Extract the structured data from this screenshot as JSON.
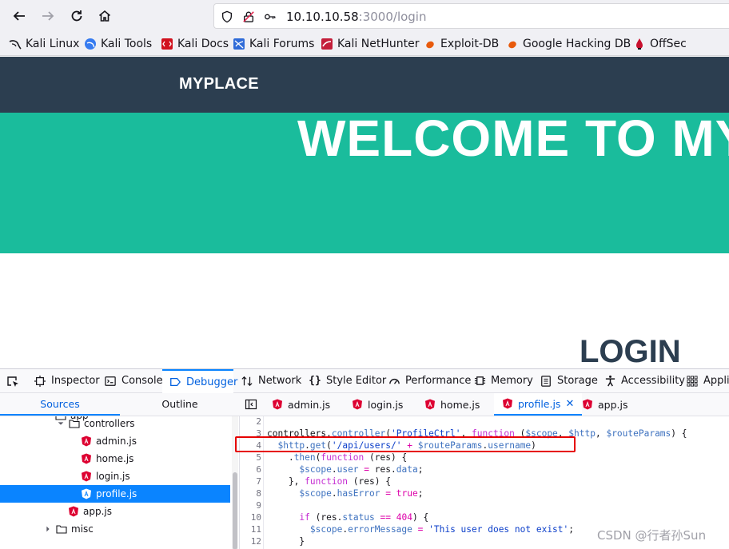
{
  "browser": {
    "url_host": "10.10.10.58",
    "url_rest": ":3000/login",
    "bookmarks": [
      "Kali Linux",
      "Kali Tools",
      "Kali Docs",
      "Kali Forums",
      "Kali NetHunter",
      "Exploit-DB",
      "Google Hacking DB",
      "OffSec"
    ]
  },
  "page": {
    "brand": "MYPLACE",
    "hero_title": "WELCOME TO MYPLACE",
    "login_heading": "LOGIN"
  },
  "devtools": {
    "tabs": [
      "Inspector",
      "Console",
      "Debugger",
      "Network",
      "Style Editor",
      "Performance",
      "Memory",
      "Storage",
      "Accessibility",
      "Applic"
    ],
    "active_tab": "Debugger",
    "pane_tabs": [
      "Sources",
      "Outline"
    ],
    "tree": {
      "partial_top": "app",
      "folder": "controllers",
      "files": [
        "admin.js",
        "home.js",
        "login.js",
        "profile.js"
      ],
      "selected": "profile.js",
      "app_file": "app.js",
      "misc_folder": "misc"
    },
    "editor_tabs": [
      "admin.js",
      "login.js",
      "home.js",
      "profile.js",
      "app.js"
    ],
    "active_editor_tab": "profile.js",
    "code_lines": [
      {
        "n": "2",
        "text": ""
      },
      {
        "n": "3",
        "text": "controllers.controller('ProfileCtrl', function ($scope, $http, $routeParams) {"
      },
      {
        "n": "4",
        "text": "  $http.get('/api/users/' + $routeParams.username)"
      },
      {
        "n": "5",
        "text": "    .then(function (res) {"
      },
      {
        "n": "6",
        "text": "      $scope.user = res.data;"
      },
      {
        "n": "7",
        "text": "    }, function (res) {"
      },
      {
        "n": "8",
        "text": "      $scope.hasError = true;"
      },
      {
        "n": "9",
        "text": ""
      },
      {
        "n": "10",
        "text": "      if (res.status == 404) {"
      },
      {
        "n": "11",
        "text": "        $scope.errorMessage = 'This user does not exist';"
      },
      {
        "n": "12",
        "text": "      }"
      }
    ]
  },
  "watermark": "CSDN @行者孙Sun",
  "colors": {
    "header_bg": "#2c3e50",
    "hero_bg": "#1abc9c",
    "accent_blue": "#0a84ff",
    "highlight_red": "#e60000",
    "angular_red": "#dd0031"
  }
}
